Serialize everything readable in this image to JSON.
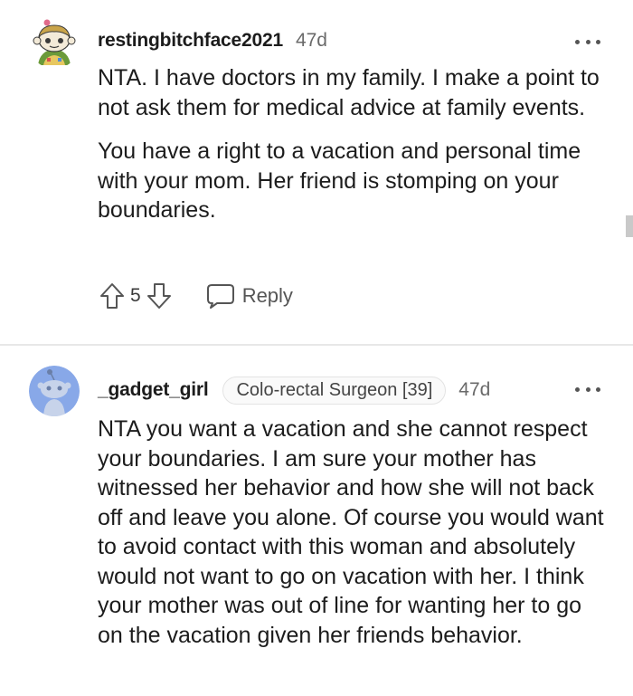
{
  "comments": [
    {
      "username": "restingbitchface2021",
      "timestamp": "47d",
      "avatar_icon": "snoo-avatar-icon",
      "paragraphs": [
        "NTA. I have doctors in my family. I make a point to not ask them for medical advice at family events.",
        "You have a right to a vacation and personal time with your mom. Her friend is stomping on your boundaries."
      ],
      "score": "5",
      "reply_label": "Reply",
      "more_icon": "more-options-icon"
    },
    {
      "username": "_gadget_girl",
      "flair": "Colo-rectal Surgeon [39]",
      "timestamp": "47d",
      "avatar_icon": "default-snoo-avatar-icon",
      "paragraphs": [
        "NTA you want a vacation and she cannot respect your boundaries. I am sure your mother has witnessed her behavior and how she will not back off and leave you alone. Of course you would want to avoid contact with this woman and absolutely would not want to go on vacation with her. I think your mother was out of line for wanting her to go on the vacation given her friends behavior."
      ],
      "more_icon": "more-options-icon"
    }
  ],
  "colors": {
    "text": "#1c1c1c",
    "muted": "#6a6a6a",
    "divider": "#e7e7e7",
    "avatar_bg": "#88a8e8"
  }
}
